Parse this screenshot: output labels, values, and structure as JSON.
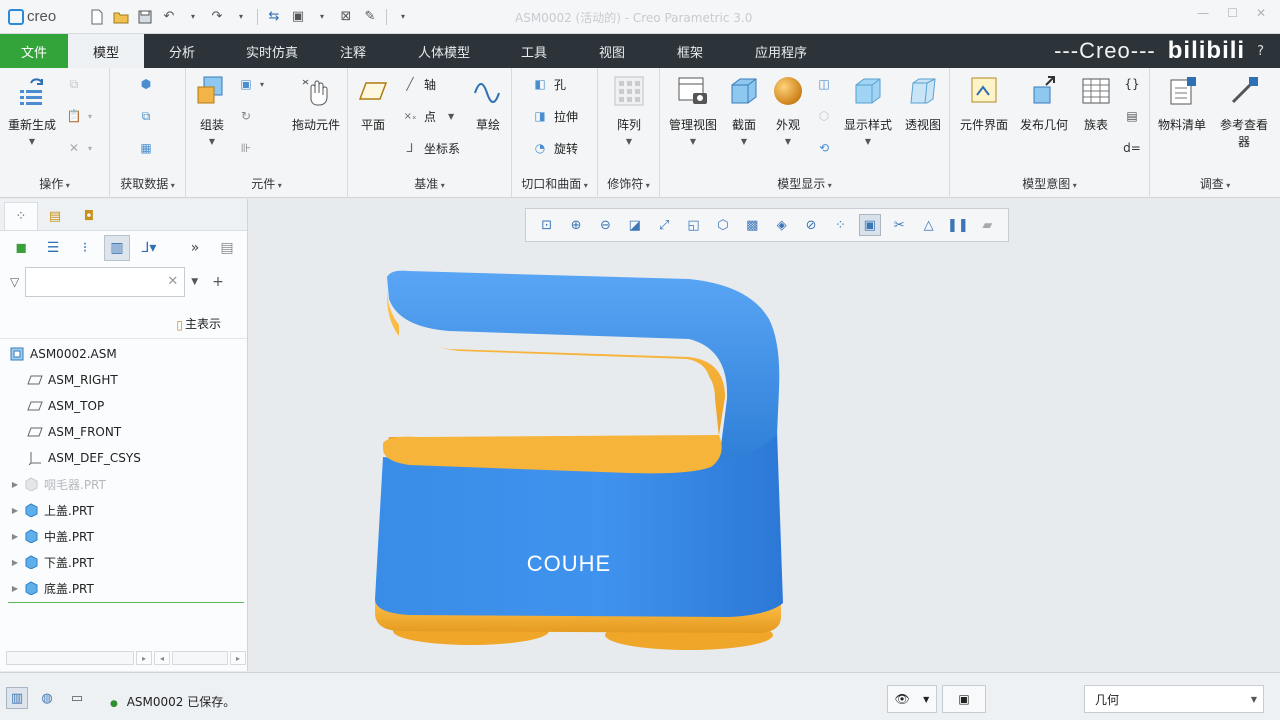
{
  "app": {
    "logo_text": "creo",
    "window_title": "ASM0002 (活动的) - Creo Parametric 3.0"
  },
  "quick_access": {
    "icons": [
      "new-icon",
      "open-icon",
      "save-icon",
      "undo-icon",
      "redo-icon",
      "regenerate-icon",
      "windows-icon",
      "close-icon",
      "customize-icon"
    ]
  },
  "ribbon_tabs": [
    {
      "label": "文件",
      "state": "file"
    },
    {
      "label": "模型",
      "state": "active"
    },
    {
      "label": "分析",
      "state": "normal"
    },
    {
      "label": "实时仿真",
      "state": "normal"
    },
    {
      "label": "注释",
      "state": "normal"
    },
    {
      "label": "人体模型",
      "state": "normal"
    },
    {
      "label": "工具",
      "state": "normal"
    },
    {
      "label": "视图",
      "state": "normal"
    },
    {
      "label": "框架",
      "state": "normal"
    },
    {
      "label": "应用程序",
      "state": "normal"
    }
  ],
  "brand": {
    "creo_text": "---Creo---",
    "bili_text": "bilibili",
    "help": "?"
  },
  "ribbon": {
    "groups": {
      "operations": "操作",
      "get_data": "获取数据",
      "component": "元件",
      "datum": "基准",
      "cut_surface": "切口和曲面",
      "modifiers": "修饰符",
      "model_display": "模型显示",
      "model_intent": "模型意图",
      "investigate": "调查"
    },
    "buttons": {
      "regenerate": "重新生成",
      "assemble": "组装",
      "drag_components": "拖动元件",
      "plane": "平面",
      "axis": "轴",
      "point": "点",
      "csys": "坐标系",
      "sketch": "草绘",
      "hole": "孔",
      "extrude": "拉伸",
      "revolve": "旋转",
      "pattern": "阵列",
      "manage_views": "管理视图",
      "section": "截面",
      "appearance": "外观",
      "display_style": "显示样式",
      "perspective": "透视图",
      "component_interface": "元件界面",
      "publish_geometry": "发布几何",
      "family_table": "族表",
      "bill_of_materials": "物料清单",
      "reference_viewer_line1": "参考查看",
      "reference_viewer_line2": "器"
    }
  },
  "model_tree": {
    "show_label": "主表示",
    "filter_placeholder": "",
    "items": [
      {
        "label": "ASM0002.ASM",
        "icon": "assembly-icon",
        "expandable": false,
        "dim": false,
        "indent": 0
      },
      {
        "label": "ASM_RIGHT",
        "icon": "datum-plane-icon",
        "expandable": false,
        "dim": false,
        "indent": 1
      },
      {
        "label": "ASM_TOP",
        "icon": "datum-plane-icon",
        "expandable": false,
        "dim": false,
        "indent": 1
      },
      {
        "label": "ASM_FRONT",
        "icon": "datum-plane-icon",
        "expandable": false,
        "dim": false,
        "indent": 1
      },
      {
        "label": "ASM_DEF_CSYS",
        "icon": "csys-icon",
        "expandable": false,
        "dim": false,
        "indent": 1
      },
      {
        "label": "咽毛器.PRT",
        "icon": "part-icon",
        "expandable": true,
        "dim": true,
        "indent": 1
      },
      {
        "label": "上盖.PRT",
        "icon": "part-icon",
        "expandable": true,
        "dim": false,
        "indent": 1
      },
      {
        "label": "中盖.PRT",
        "icon": "part-icon",
        "expandable": true,
        "dim": false,
        "indent": 1
      },
      {
        "label": "下盖.PRT",
        "icon": "part-icon",
        "expandable": true,
        "dim": false,
        "indent": 1
      },
      {
        "label": "底盖.PRT",
        "icon": "part-icon",
        "expandable": true,
        "dim": false,
        "indent": 1
      }
    ]
  },
  "model": {
    "label": "COUHE",
    "colors": {
      "body": "#3f8fe8",
      "trim": "#f3ad32"
    }
  },
  "status": {
    "message": "ASM0002 已保存。",
    "filter_value": "几何"
  },
  "colors": {
    "file_tab": "#33a43a",
    "tabbar": "#2c3339",
    "accent": "#2f6fb3"
  }
}
